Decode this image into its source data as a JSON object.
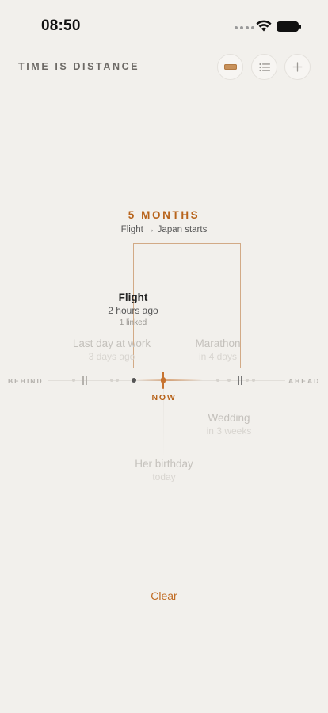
{
  "status_bar": {
    "time": "08:50",
    "icons": [
      "cellular-dots-icon",
      "wifi-icon",
      "battery-icon"
    ]
  },
  "header": {
    "title": "TIME IS DISTANCE",
    "buttons": [
      {
        "name": "ruler-button",
        "icon": "ruler-icon",
        "accent": "#c8915a"
      },
      {
        "name": "list-button",
        "icon": "list-icon"
      },
      {
        "name": "add-button",
        "icon": "plus-icon"
      }
    ]
  },
  "focus": {
    "duration": "5 MONTHS",
    "description": "Flight → Japan starts"
  },
  "timeline": {
    "behind_label": "BEHIND",
    "ahead_label": "AHEAD",
    "now_label": "NOW",
    "events": [
      {
        "title": "Flight",
        "subtitle": "2 hours ago",
        "linked": "1 linked",
        "state": "selected"
      },
      {
        "title": "Last day at work",
        "subtitle": "3 days ago",
        "state": "faded"
      },
      {
        "title": "Marathon",
        "subtitle": "in 4 days",
        "state": "faded"
      },
      {
        "title": "Wedding",
        "subtitle": "in 3 weeks",
        "state": "faded"
      },
      {
        "title": "Her birthday",
        "subtitle": "today",
        "state": "faded"
      }
    ]
  },
  "footer": {
    "clear_label": "Clear"
  },
  "colors": {
    "background": "#f2f0ec",
    "accent": "#b8641c",
    "text_primary": "#222222",
    "text_faded": "#c4c1bc"
  }
}
